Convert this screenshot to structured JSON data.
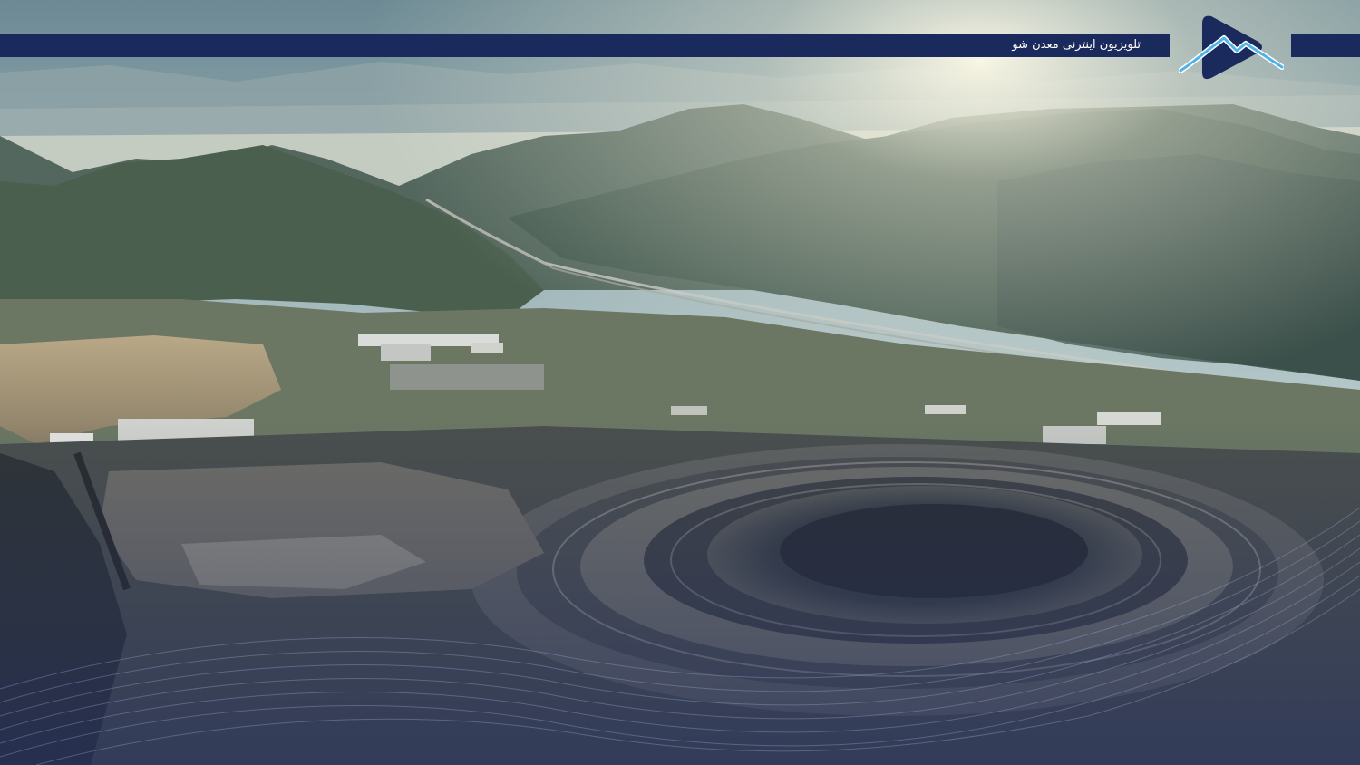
{
  "banner": {
    "title": "تلویزیون اینترنی معدن شو"
  },
  "logo": {
    "icon": "mountain-play-icon",
    "colors": {
      "badge": "#1b2a5c",
      "mountain": "#4fb3e8"
    }
  },
  "scene": {
    "subject": "aerial-view-open-pit-mine-in-mountain-valley"
  },
  "colors": {
    "banner": "#1b2a5c",
    "text": "#ffffff",
    "overlay": "#22305f"
  }
}
